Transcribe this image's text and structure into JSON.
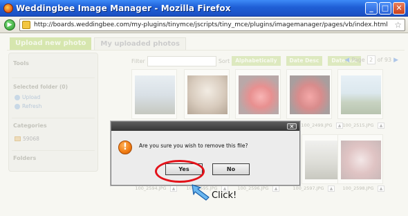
{
  "window": {
    "title": "Weddingbee Image Manager - Mozilla Firefox",
    "controls": {
      "minimize": "_",
      "maximize": "□",
      "close": "✕"
    }
  },
  "browser": {
    "url": "http://boards.weddingbee.com/my-plugins/tinymce/jscripts/tiny_mce/plugins/imagemanager/pages/vb/index.html",
    "go_icon": "▶",
    "star_icon": "☆"
  },
  "tabs": [
    {
      "label": "Upload new photo"
    },
    {
      "label": "My uploaded photos"
    }
  ],
  "sidebar": {
    "tools_heading": "Tools",
    "selected_folder": "Selected folder (0)",
    "actions": [
      {
        "label": "Upload"
      },
      {
        "label": "Refresh"
      }
    ],
    "categories_heading": "Categories",
    "category": "59068",
    "folders_heading": "Folders"
  },
  "toolbar": {
    "filter_label": "Filter",
    "sort_label": "Sort",
    "sort_options": [
      "Alphabetically",
      "Date Desc",
      "Date Asc"
    ]
  },
  "pager": {
    "prev": "◀",
    "label": "Page",
    "current": "2",
    "total": "of 93",
    "next": "▶"
  },
  "thumbnails": {
    "row2_captions": [
      "100_2499.JPG",
      "100_2515.JPG"
    ],
    "row3_captions": [
      "100_2594.JPG",
      "100_2595.JPG",
      "100_2596.JPG",
      "100_2597.JPG",
      "100_2598.JPG"
    ],
    "up_icon": "▲"
  },
  "dialog": {
    "close": "×",
    "icon": "!",
    "message": "Are you sure you wish to remove this file?",
    "yes": "Yes",
    "no": "No"
  },
  "annotation": {
    "label": "Click!"
  },
  "colors": {
    "title_bar": "#2a63d8",
    "highlight_ring": "#e3121a",
    "dialog_header": "#353535"
  }
}
